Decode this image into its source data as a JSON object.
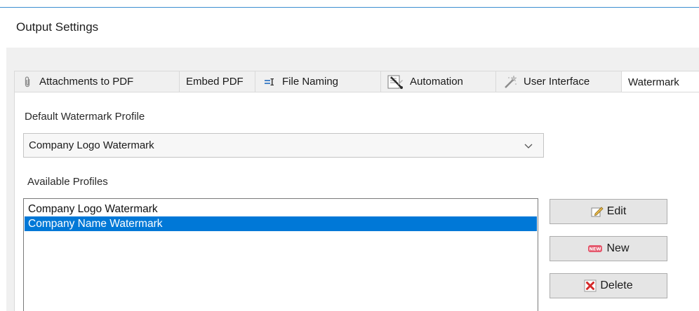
{
  "window": {
    "title": "Output Settings"
  },
  "tabs": [
    {
      "label": "Attachments to PDF",
      "icon": "paperclip-icon"
    },
    {
      "label": "Embed PDF",
      "icon": ""
    },
    {
      "label": "File Naming",
      "icon": "file-naming-icon"
    },
    {
      "label": "Automation",
      "icon": "automation-icon"
    },
    {
      "label": "User Interface",
      "icon": "magic-wand-icon"
    },
    {
      "label": "Watermark",
      "icon": "",
      "active": true
    }
  ],
  "watermark": {
    "default_label": "Default Watermark Profile",
    "default_value": "Company Logo Watermark",
    "available_label": "Available Profiles",
    "profiles": [
      {
        "name": "Company Logo Watermark",
        "selected": false
      },
      {
        "name": "Company Name Watermark",
        "selected": true
      }
    ],
    "buttons": {
      "edit": "Edit",
      "new": "New",
      "delete": "Delete"
    },
    "new_badge": "NEW"
  },
  "colors": {
    "selection": "#0078d7",
    "accent_line": "#3c8fd0",
    "delete_red": "#d42a2a"
  }
}
